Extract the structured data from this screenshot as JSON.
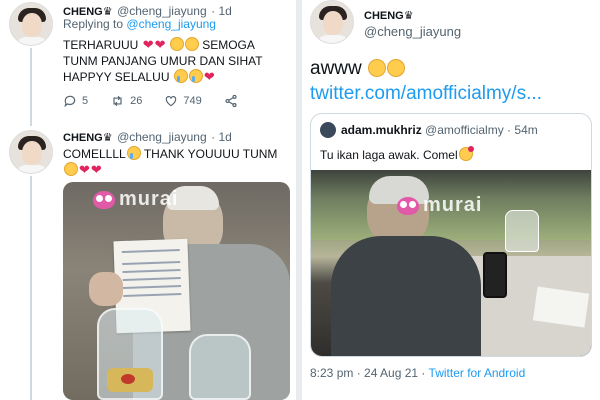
{
  "left": {
    "tweet1": {
      "display_name": "CHENG",
      "handle": "@cheng_jiayung",
      "age": "1d",
      "replying_label": "Replying to",
      "replying_handle": "@cheng_jiayung",
      "text_line1": "TERHARUUU",
      "text_line1b": "SEMOGA",
      "text_line2": "TUNM PANJANG UMUR DAN SIHAT",
      "text_line3": "HAPPYY SELALUU",
      "replies": "5",
      "retweets": "26",
      "likes": "749"
    },
    "tweet2": {
      "display_name": "CHENG",
      "handle": "@cheng_jiayung",
      "age": "1d",
      "text_line1": "COMELLLL",
      "text_line1b": "THANK YOUUUU TUNM"
    },
    "photo_watermark": "murai"
  },
  "right": {
    "tweet": {
      "display_name": "CHENG",
      "handle": "@cheng_jiayung",
      "text": "awww",
      "link": "twitter.com/amofficialmy/s...",
      "timestamp": "8:23 pm · 24 Aug 21 ·",
      "source": "Twitter for Android"
    },
    "quoted": {
      "display_name": "adam.mukhriz",
      "handle": "@amofficialmy",
      "age": "54m",
      "text": "Tu ikan laga awak. Comel"
    },
    "photo_watermark": "murai"
  },
  "colors": {
    "accent": "#1d9bf0",
    "heart": "#e0245e",
    "text": "#0f1419",
    "muted": "#536471"
  },
  "icons": [
    "reply-icon",
    "retweet-icon",
    "like-icon",
    "share-icon",
    "crown-icon"
  ]
}
